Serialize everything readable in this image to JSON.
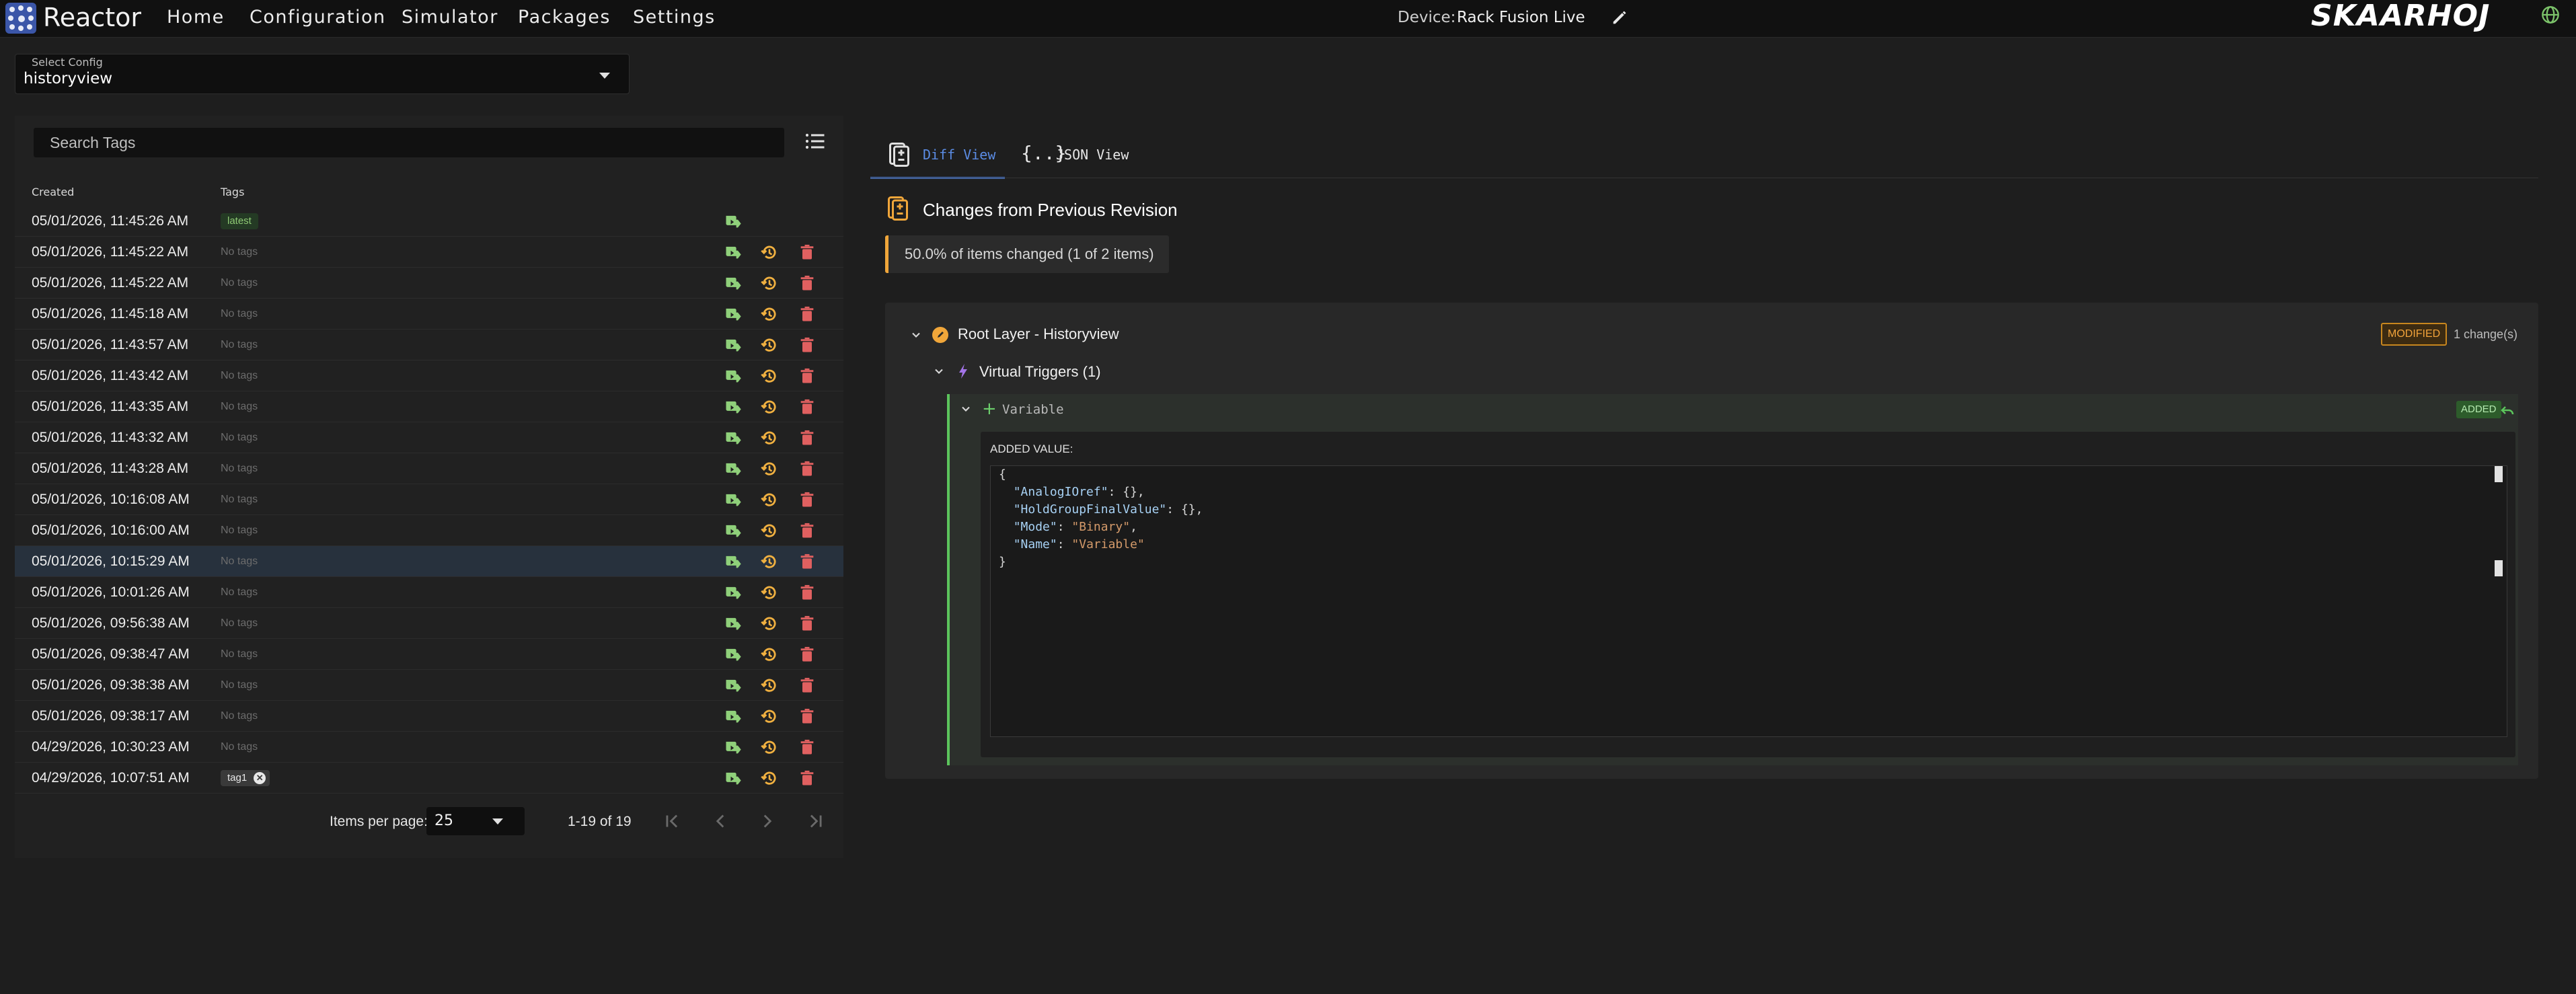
{
  "app": {
    "brand": "Reactor",
    "nav": [
      "Home",
      "Configuration",
      "Simulator",
      "Packages",
      "Settings"
    ],
    "device_label": "Device:",
    "device_name": "Rack Fusion Live",
    "vendor_logo": "SKAARHOJ",
    "icons": {
      "logo": "reactor-logo-icon",
      "edit": "pencil-icon",
      "network": "globe-icon"
    }
  },
  "config_select": {
    "label": "Select Config",
    "value": "historyview"
  },
  "history": {
    "search_placeholder": "Search Tags",
    "columns": {
      "created": "Created",
      "tags": "Tags"
    },
    "no_tags_text": "No tags",
    "rows": [
      {
        "created": "05/01/2026, 11:45:26 AM",
        "tag": "latest",
        "tag_type": "latest",
        "selected": false
      },
      {
        "created": "05/01/2026, 11:45:22 AM",
        "tag": "No tags",
        "tag_type": "none",
        "selected": false
      },
      {
        "created": "05/01/2026, 11:45:22 AM",
        "tag": "No tags",
        "tag_type": "none",
        "selected": false
      },
      {
        "created": "05/01/2026, 11:45:18 AM",
        "tag": "No tags",
        "tag_type": "none",
        "selected": false
      },
      {
        "created": "05/01/2026, 11:43:57 AM",
        "tag": "No tags",
        "tag_type": "none",
        "selected": false
      },
      {
        "created": "05/01/2026, 11:43:42 AM",
        "tag": "No tags",
        "tag_type": "none",
        "selected": false
      },
      {
        "created": "05/01/2026, 11:43:35 AM",
        "tag": "No tags",
        "tag_type": "none",
        "selected": false
      },
      {
        "created": "05/01/2026, 11:43:32 AM",
        "tag": "No tags",
        "tag_type": "none",
        "selected": false
      },
      {
        "created": "05/01/2026, 11:43:28 AM",
        "tag": "No tags",
        "tag_type": "none",
        "selected": false
      },
      {
        "created": "05/01/2026, 10:16:08 AM",
        "tag": "No tags",
        "tag_type": "none",
        "selected": false
      },
      {
        "created": "05/01/2026, 10:16:00 AM",
        "tag": "No tags",
        "tag_type": "none",
        "selected": false
      },
      {
        "created": "05/01/2026, 10:15:29 AM",
        "tag": "No tags",
        "tag_type": "none",
        "selected": true
      },
      {
        "created": "05/01/2026, 10:01:26 AM",
        "tag": "No tags",
        "tag_type": "none",
        "selected": false
      },
      {
        "created": "05/01/2026, 09:56:38 AM",
        "tag": "No tags",
        "tag_type": "none",
        "selected": false
      },
      {
        "created": "05/01/2026, 09:38:47 AM",
        "tag": "No tags",
        "tag_type": "none",
        "selected": false
      },
      {
        "created": "05/01/2026, 09:38:38 AM",
        "tag": "No tags",
        "tag_type": "none",
        "selected": false
      },
      {
        "created": "05/01/2026, 09:38:17 AM",
        "tag": "No tags",
        "tag_type": "none",
        "selected": false
      },
      {
        "created": "04/29/2026, 10:30:23 AM",
        "tag": "No tags",
        "tag_type": "none",
        "selected": false
      },
      {
        "created": "04/29/2026, 10:07:51 AM",
        "tag": "tag1",
        "tag_type": "tag",
        "selected": false
      }
    ],
    "pagination": {
      "items_per_page_label": "Items per page:",
      "items_per_page": "25",
      "range": "1-19 of 19"
    }
  },
  "diff": {
    "tabs": [
      {
        "label": "Diff View",
        "icon": "diff-icon",
        "active": true
      },
      {
        "label": "JSON View",
        "icon": "braces-icon",
        "active": false
      }
    ],
    "title": "Changes from Previous Revision",
    "summary": "50.0% of items changed (1 of 2 items)",
    "layer": {
      "title": "Root Layer - Historyview",
      "status_badge": "MODIFIED",
      "change_count": "1 change(s)",
      "group": {
        "title": "Virtual Triggers (1)",
        "item": {
          "name": "Variable",
          "status_badge": "ADDED",
          "added_value_label": "ADDED VALUE:",
          "code_lines": [
            [
              {
                "t": "{",
                "c": "p"
              }
            ],
            [
              {
                "t": "  ",
                "c": "p"
              },
              {
                "t": "\"AnalogIOref\"",
                "c": "k"
              },
              {
                "t": ": {},",
                "c": "p"
              }
            ],
            [
              {
                "t": "  ",
                "c": "p"
              },
              {
                "t": "\"HoldGroupFinalValue\"",
                "c": "k"
              },
              {
                "t": ": {},",
                "c": "p"
              }
            ],
            [
              {
                "t": "  ",
                "c": "p"
              },
              {
                "t": "\"Mode\"",
                "c": "k"
              },
              {
                "t": ": ",
                "c": "p"
              },
              {
                "t": "\"Binary\"",
                "c": "s"
              },
              {
                "t": ",",
                "c": "p"
              }
            ],
            [
              {
                "t": "  ",
                "c": "p"
              },
              {
                "t": "\"Name\"",
                "c": "k"
              },
              {
                "t": ": ",
                "c": "p"
              },
              {
                "t": "\"Variable\"",
                "c": "s"
              }
            ],
            [
              {
                "t": "}",
                "c": "p"
              }
            ]
          ]
        }
      }
    }
  },
  "colors": {
    "accent_blue": "#4a7bd6",
    "modified_orange": "#f0a63a",
    "added_green": "#5cc45c",
    "delete_red": "#e06060",
    "restore_amber": "#f0b040",
    "load_green": "#8fd07a"
  }
}
